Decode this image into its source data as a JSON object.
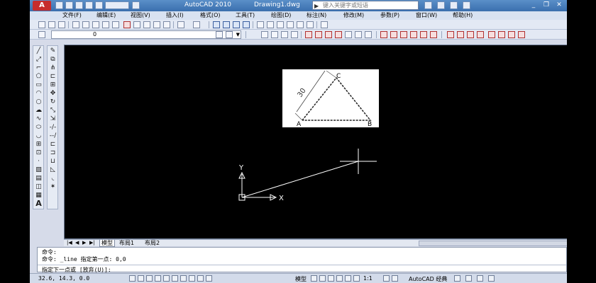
{
  "window": {
    "app_title": "AutoCAD 2010",
    "document_title": "Drawing1.dwg",
    "search_placeholder": "键入关键字或短语",
    "app_logo_text": "A"
  },
  "menu": {
    "items": [
      "文件(F)",
      "编辑(E)",
      "视图(V)",
      "插入(I)",
      "格式(O)",
      "工具(T)",
      "绘图(D)",
      "标注(N)",
      "修改(M)",
      "参数(P)",
      "窗口(W)",
      "帮助(H)"
    ]
  },
  "layer_toolbar": {
    "current_layer": "0"
  },
  "reference_image": {
    "dimension_text": "30",
    "point_a": "A",
    "point_b": "B",
    "point_c": "C"
  },
  "ucs": {
    "x_label": "X",
    "y_label": "Y"
  },
  "layout_tabs": {
    "tabs": [
      "模型",
      "布局1",
      "布局2"
    ],
    "active": "模型"
  },
  "command_window": {
    "lines": [
      "命令:",
      "命令: _line 指定第一点: 0,0"
    ],
    "prompt": "指定下一点或 [放弃(U)]:"
  },
  "statusbar": {
    "coordinates": "32.6, 14.3, 0.0",
    "model_label": "模型",
    "annotation_scale": "1:1",
    "workspace": "AutoCAD 经典"
  },
  "colors": {
    "canvas": "#000000",
    "drawing_line": "#ffffff",
    "title_bar": "#3a6fae",
    "brand_red": "#c62d2d"
  }
}
